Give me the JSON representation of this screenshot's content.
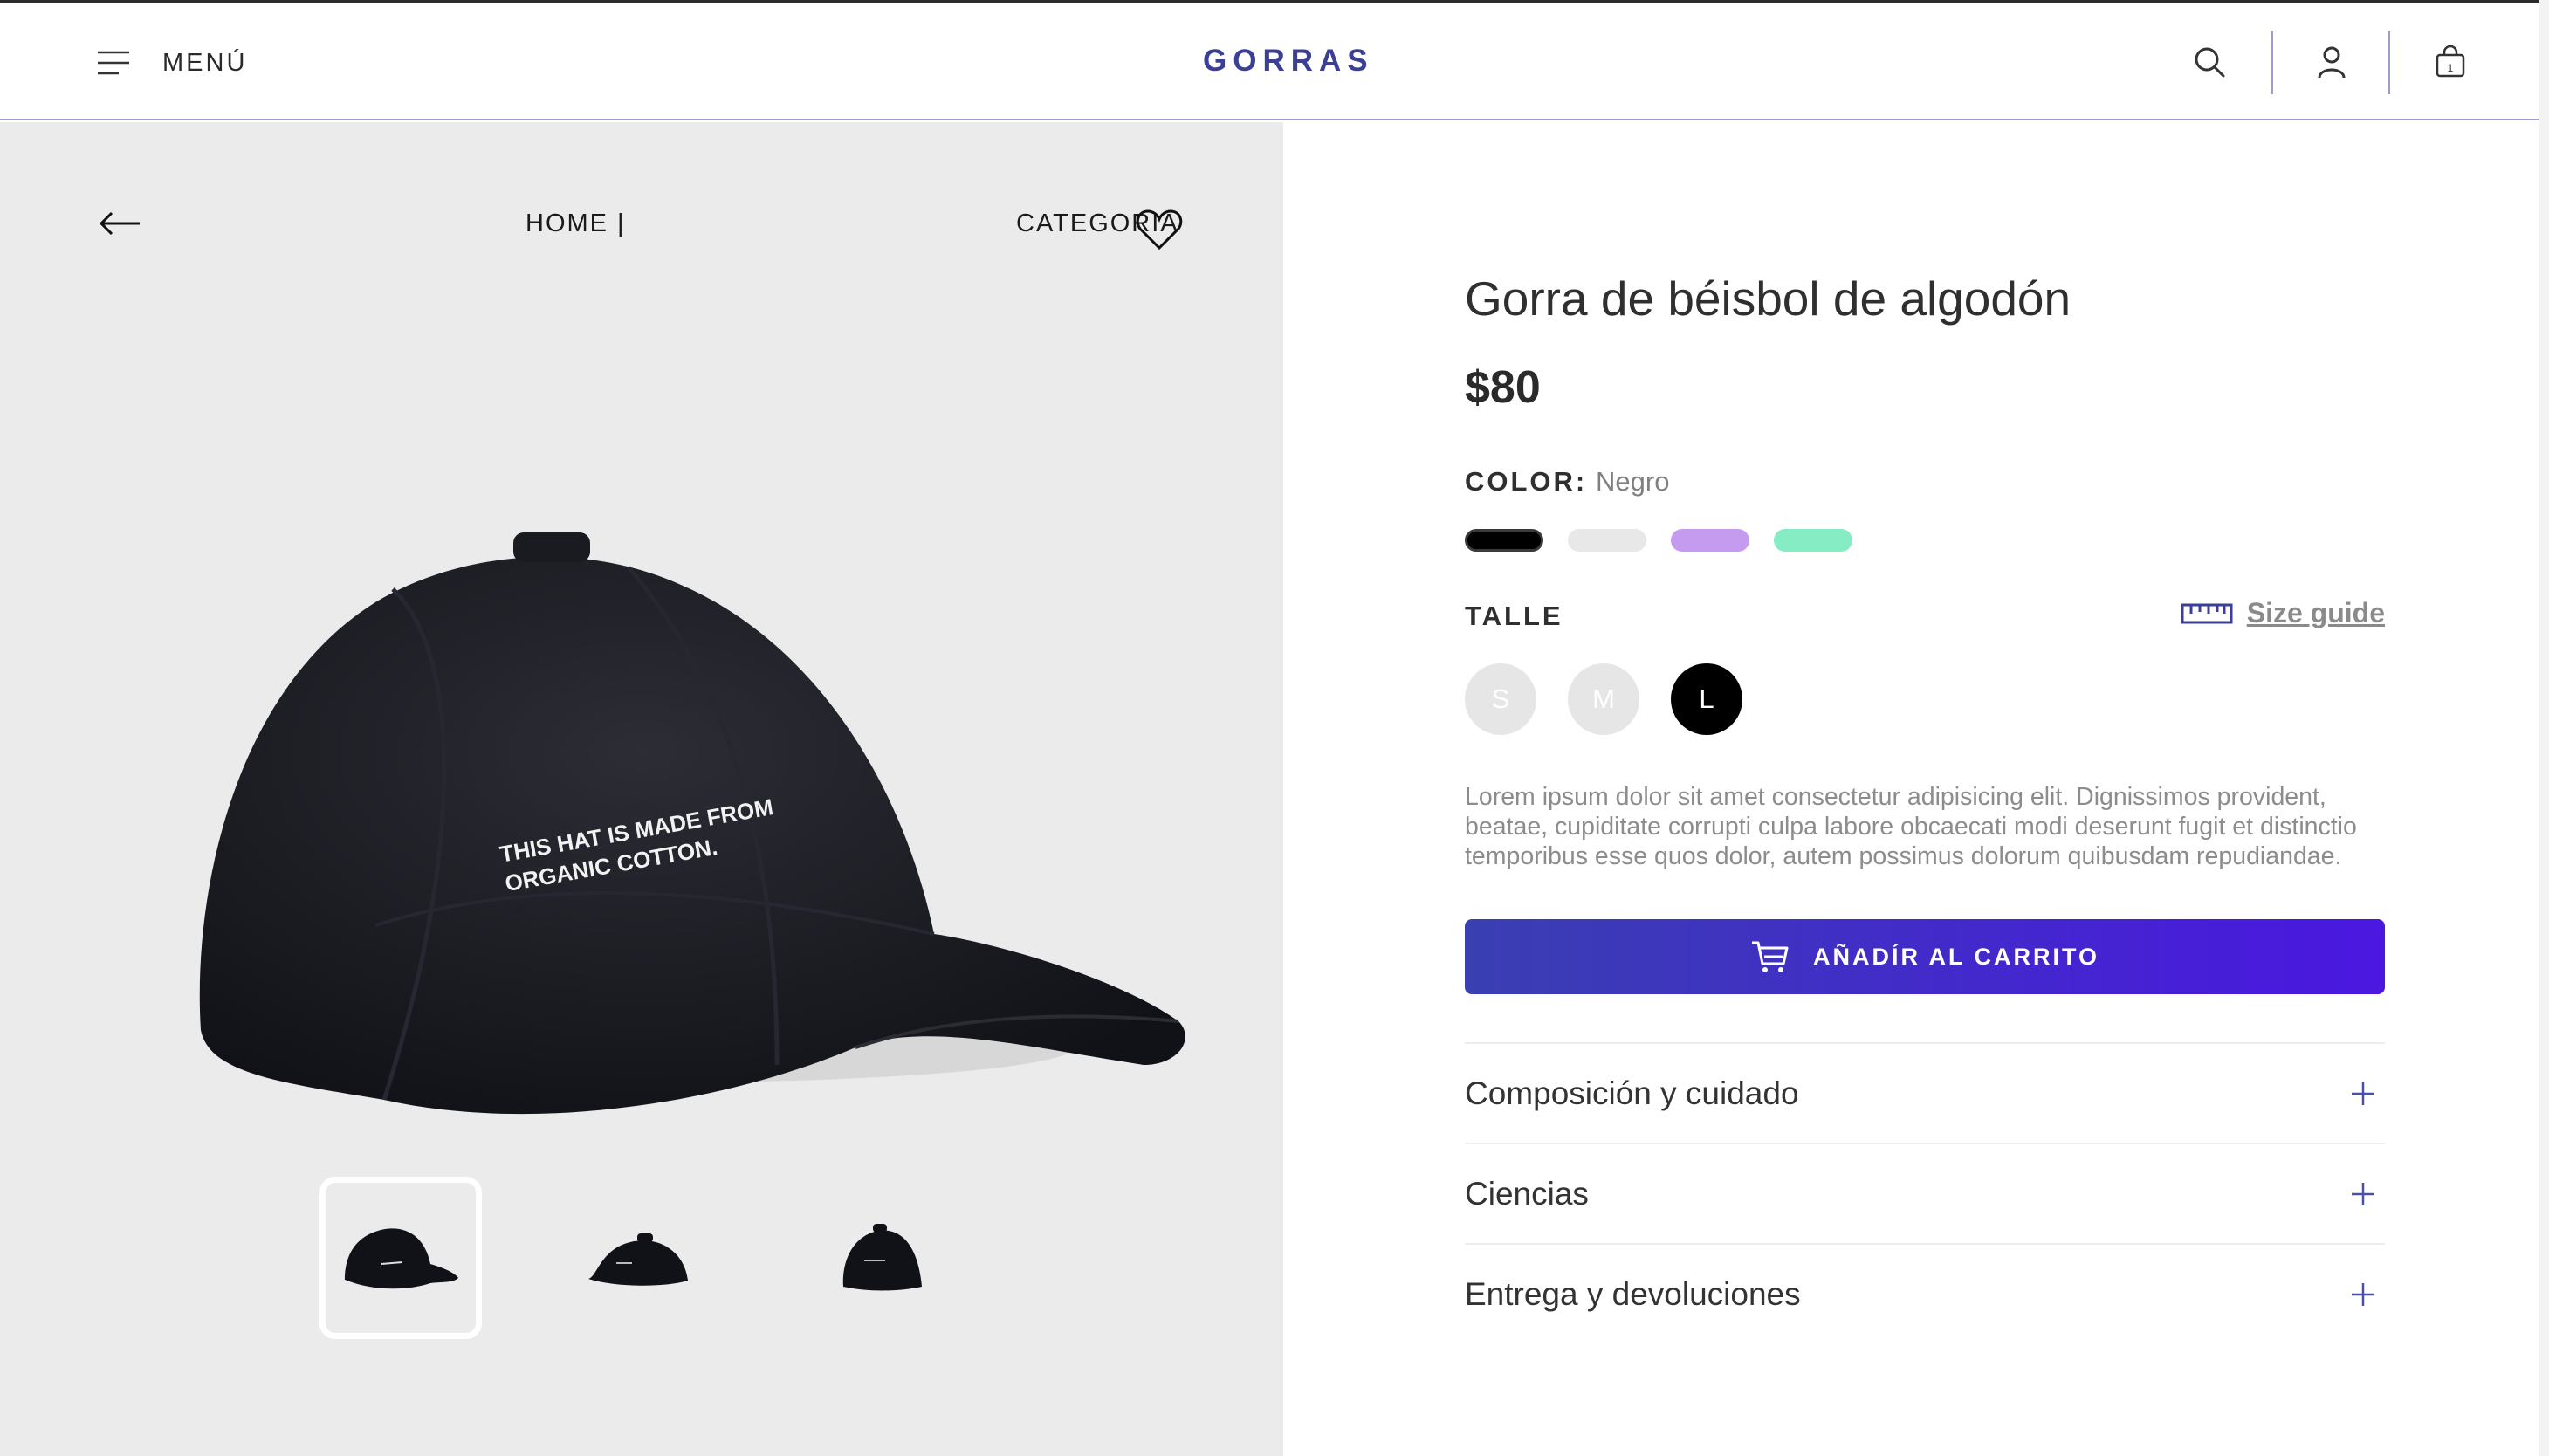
{
  "header": {
    "menu_label": "MENÚ",
    "brand": "GORRAS",
    "icons": [
      "menu-icon",
      "search-icon",
      "user-icon",
      "bag-icon"
    ],
    "cart_count": "1",
    "brand_color": "#3b3f96"
  },
  "gallery": {
    "breadcrumb": {
      "home": "HOME |",
      "category": "CATEGORIA"
    },
    "image_text": [
      "THIS HAT IS MADE FROM",
      "ORGANIC COTTON."
    ],
    "thumbnails": [
      "front",
      "back",
      "side"
    ],
    "active_thumbnail": 0
  },
  "product": {
    "title": "Gorra de béisbol de algodón",
    "price": "$80",
    "color_label": "COLOR:",
    "color_value": "Negro",
    "colors": [
      "#000000",
      "#e8e8e8",
      "#c59bf0",
      "#86ecc4"
    ],
    "selected_color": 0,
    "size_label": "TALLE",
    "size_guide": "Size guide",
    "sizes": [
      "S",
      "M",
      "L"
    ],
    "selected_size": "L",
    "description": "Lorem ipsum dolor sit amet consectetur adipisicing elit. Dignissimos provident, beatae, cupiditate corrupti culpa labore obcaecati modi deserunt fugit et distinctio temporibus esse quos dolor, autem possimus dolorum quibusdam repudiandae.",
    "add_to_cart": "AÑADÍR AL CARRITO",
    "accordion": [
      "Composición y cuidado",
      "Ciencias",
      "Entrega y devoluciones"
    ]
  }
}
